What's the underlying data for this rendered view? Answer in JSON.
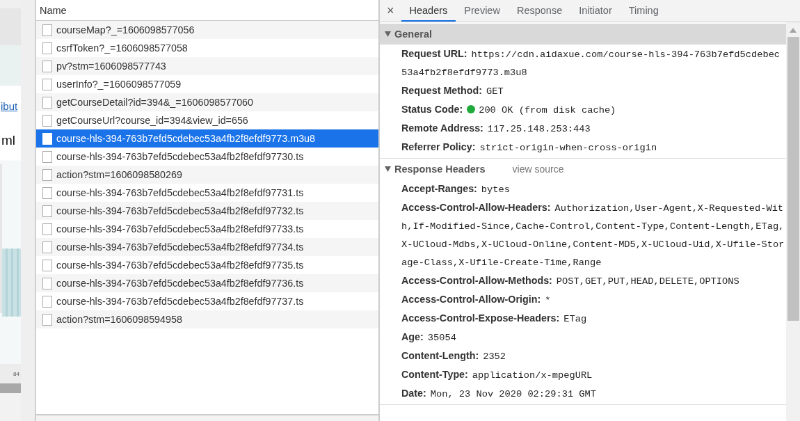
{
  "background_page": {
    "link": "ibut",
    "text": "ml",
    "zoom": "84"
  },
  "network": {
    "column": "Name",
    "requests": [
      {
        "name": "courseMap?_=1606098577056",
        "selected": false
      },
      {
        "name": "csrfToken?_=1606098577058",
        "selected": false
      },
      {
        "name": "pv?stm=1606098577743",
        "selected": false
      },
      {
        "name": "userInfo?_=1606098577059",
        "selected": false
      },
      {
        "name": "getCourseDetail?id=394&_=1606098577060",
        "selected": false
      },
      {
        "name": "getCourseUrl?course_id=394&view_id=656",
        "selected": false
      },
      {
        "name": "course-hls-394-763b7efd5cdebec53a4fb2f8efdf9773.m3u8",
        "selected": true
      },
      {
        "name": "course-hls-394-763b7efd5cdebec53a4fb2f8efdf97730.ts",
        "selected": false
      },
      {
        "name": "action?stm=1606098580269",
        "selected": false
      },
      {
        "name": "course-hls-394-763b7efd5cdebec53a4fb2f8efdf97731.ts",
        "selected": false
      },
      {
        "name": "course-hls-394-763b7efd5cdebec53a4fb2f8efdf97732.ts",
        "selected": false
      },
      {
        "name": "course-hls-394-763b7efd5cdebec53a4fb2f8efdf97733.ts",
        "selected": false
      },
      {
        "name": "course-hls-394-763b7efd5cdebec53a4fb2f8efdf97734.ts",
        "selected": false
      },
      {
        "name": "course-hls-394-763b7efd5cdebec53a4fb2f8efdf97735.ts",
        "selected": false
      },
      {
        "name": "course-hls-394-763b7efd5cdebec53a4fb2f8efdf97736.ts",
        "selected": false
      },
      {
        "name": "course-hls-394-763b7efd5cdebec53a4fb2f8efdf97737.ts",
        "selected": false
      },
      {
        "name": "action?stm=1606098594958",
        "selected": false
      }
    ]
  },
  "details": {
    "close": "×",
    "tabs": [
      {
        "label": "Headers",
        "selected": true
      },
      {
        "label": "Preview",
        "selected": false
      },
      {
        "label": "Response",
        "selected": false
      },
      {
        "label": "Initiator",
        "selected": false
      },
      {
        "label": "Timing",
        "selected": false
      }
    ],
    "sections": [
      {
        "title": "General",
        "expanded": true,
        "highlighted": true,
        "rows": [
          {
            "kind": "plain",
            "name": "Request URL:",
            "value": "https://cdn.aidaxue.com/course-hls-394-763b7efd5cdebec53a4fb2f8efdf9773.m3u8"
          },
          {
            "kind": "plain",
            "name": "Request Method:",
            "value": "GET"
          },
          {
            "kind": "status",
            "name": "Status Code:",
            "value": "200 OK (from disk cache)"
          },
          {
            "kind": "plain",
            "name": "Remote Address:",
            "value": "117.25.148.253:443"
          },
          {
            "kind": "plain",
            "name": "Referrer Policy:",
            "value": "strict-origin-when-cross-origin"
          }
        ]
      },
      {
        "title": "Response Headers",
        "expanded": true,
        "highlighted": false,
        "link": "view source",
        "rows": [
          {
            "kind": "plain",
            "name": "Accept-Ranges:",
            "value": "bytes"
          },
          {
            "kind": "plain",
            "name": "Access-Control-Allow-Headers:",
            "value": "Authorization,User-Agent,X-Requested-With,If-Modified-Since,Cache-Control,Content-Type,Content-Length,ETag,X-UCloud-Mdbs,X-UCloud-Online,Content-MD5,X-UCloud-Uid,X-Ufile-Storage-Class,X-Ufile-Create-Time,Range"
          },
          {
            "kind": "plain",
            "name": "Access-Control-Allow-Methods:",
            "value": "POST,GET,PUT,HEAD,DELETE,OPTIONS"
          },
          {
            "kind": "plain",
            "name": "Access-Control-Allow-Origin:",
            "value": "*"
          },
          {
            "kind": "plain",
            "name": "Access-Control-Expose-Headers:",
            "value": "ETag"
          },
          {
            "kind": "plain",
            "name": "Age:",
            "value": "35054"
          },
          {
            "kind": "plain",
            "name": "Content-Length:",
            "value": "2352"
          },
          {
            "kind": "plain",
            "name": "Content-Type:",
            "value": "application/x-mpegURL"
          },
          {
            "kind": "plain",
            "name": "Date:",
            "value": "Mon, 23 Nov 2020 02:29:31 GMT"
          }
        ]
      }
    ]
  }
}
